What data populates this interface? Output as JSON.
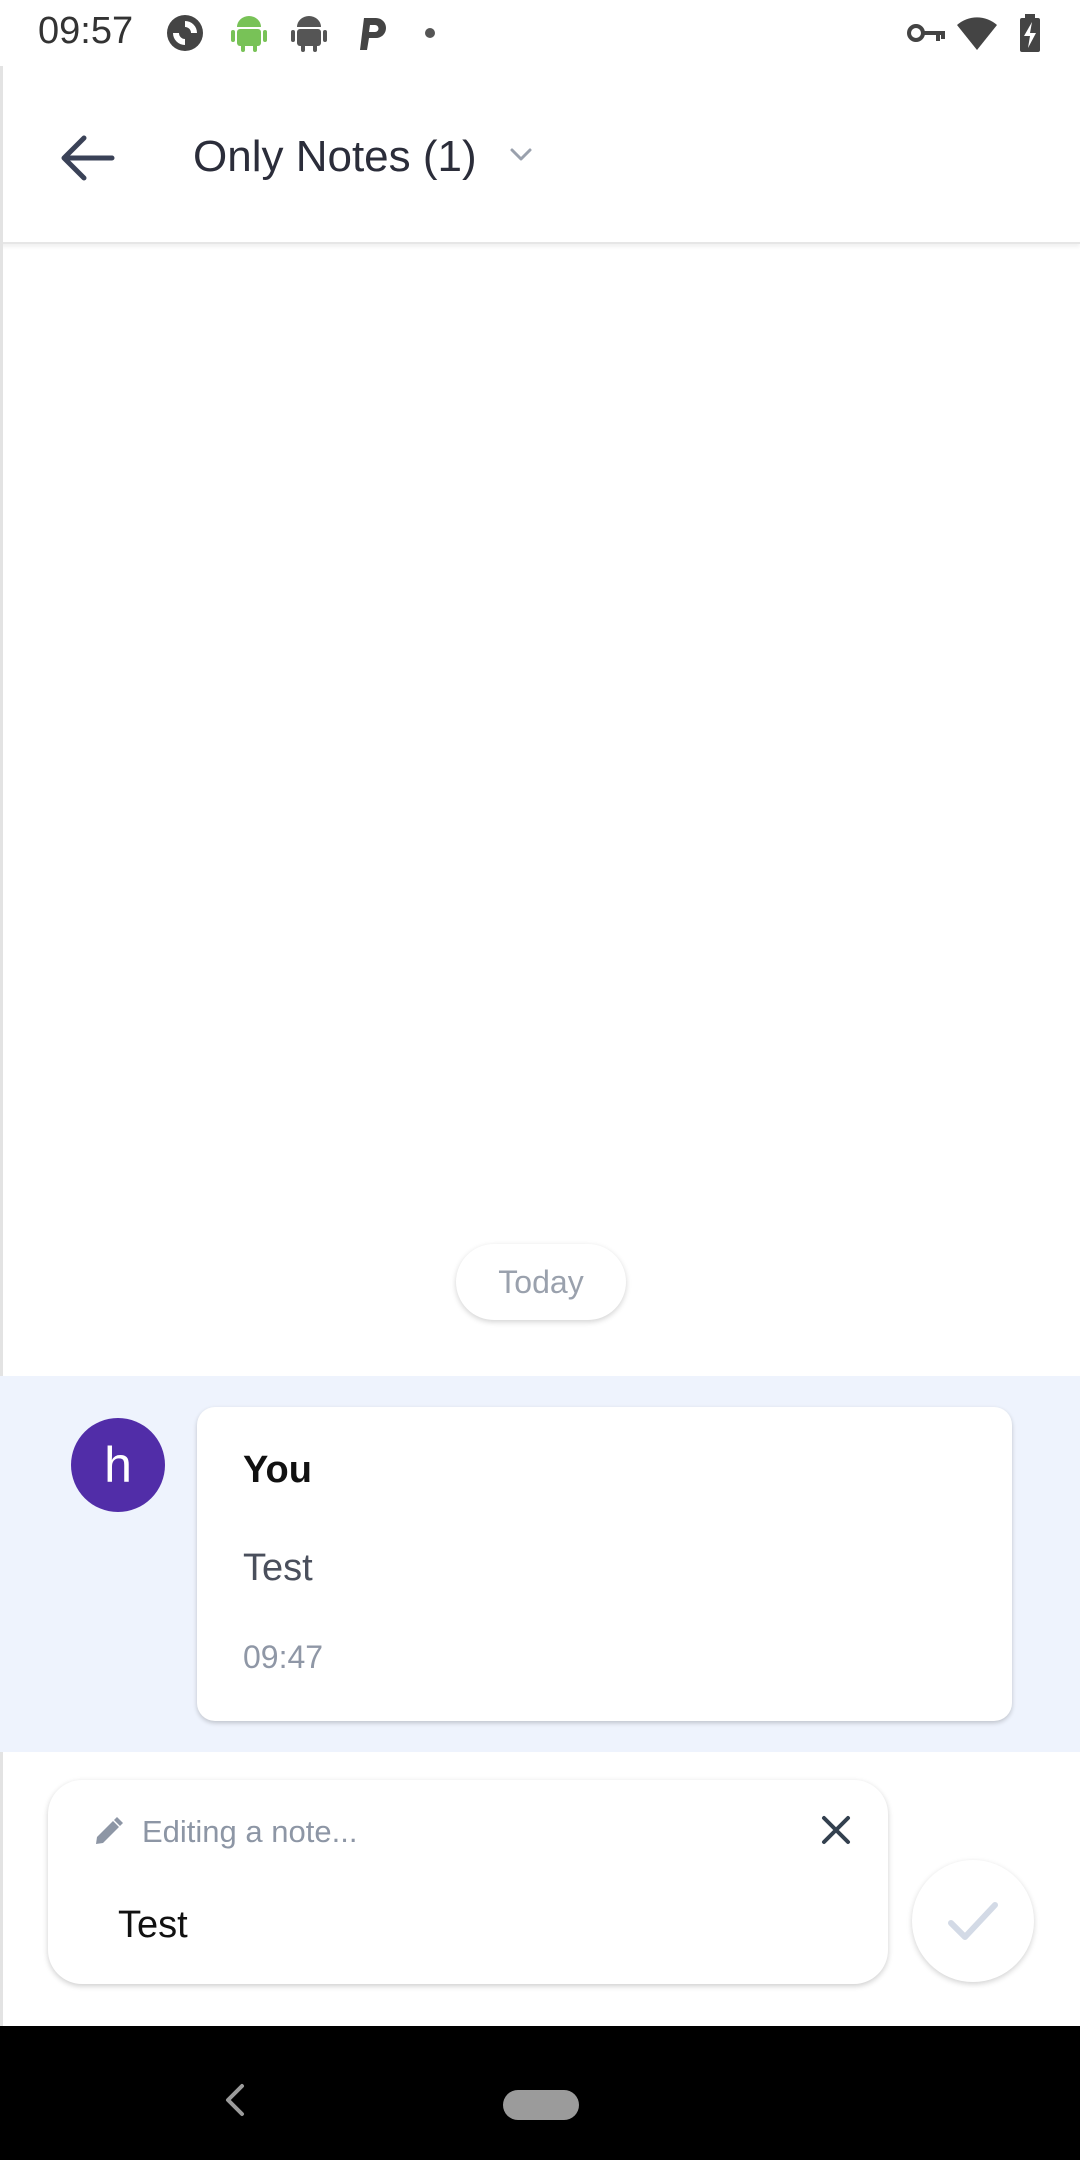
{
  "status_bar": {
    "time": "09:57",
    "icons": [
      "sync-icon",
      "android-icon",
      "android-icon",
      "p-icon",
      "dot-icon",
      "vpn-key-icon",
      "wifi-icon",
      "battery-charging-icon"
    ]
  },
  "header": {
    "back_icon": "arrow-back-icon",
    "title": "Only Notes (1)",
    "dropdown_icon": "chevron-down-icon"
  },
  "date_separator": "Today",
  "note": {
    "avatar_letter": "h",
    "avatar_color": "#512da8",
    "author": "You",
    "text": "Test",
    "time": "09:47"
  },
  "composer": {
    "status": "Editing a note...",
    "value": "Test",
    "close_icon": "close-icon",
    "confirm_icon": "check-icon"
  },
  "colors": {
    "accent": "#512da8",
    "note_band": "#eef3fd",
    "muted_text": "#8d96a5"
  }
}
